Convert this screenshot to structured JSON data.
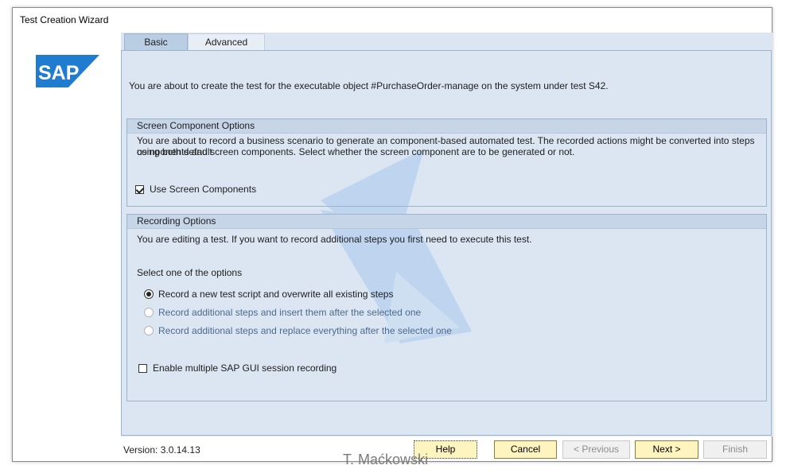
{
  "window": {
    "title": "Test Creation Wizard"
  },
  "logo": {
    "text": "SAP",
    "color": "#1f7ccf"
  },
  "tabs": [
    {
      "label": "Basic",
      "active": true
    },
    {
      "label": "Advanced",
      "active": false
    }
  ],
  "intro_text": "You are about to create the test for the executable object #PurchaseOrder-manage on the system under test S42.",
  "screen_component": {
    "header": "Screen Component Options",
    "description_line1": "You are about to record a business scenario to generate an component-based automated test. The recorded actions might be converted into steps using both default",
    "description_line2": "components and screen components. Select whether the screen component are to be generated or not.",
    "checkbox_label": "Use Screen Components",
    "checkbox_checked": true
  },
  "recording": {
    "header": "Recording Options",
    "description": "You are editing a test. If you want to record additional steps you first need to execute this test.",
    "select_label": "Select one of the options",
    "options": [
      {
        "label": "Record a new test script and overwrite all existing steps",
        "selected": true,
        "enabled": true
      },
      {
        "label": "Record additional steps and insert them after the selected one",
        "selected": false,
        "enabled": false
      },
      {
        "label": "Record additional steps and replace everything after the selected one",
        "selected": false,
        "enabled": false
      }
    ],
    "multi_session_label": "Enable multiple SAP GUI session recording",
    "multi_session_checked": false
  },
  "footer": {
    "version": "Version: 3.0.14.13",
    "help": "Help",
    "cancel": "Cancel",
    "previous": "< Previous",
    "next": "Next >",
    "finish": "Finish"
  },
  "author": "T. Maćkowski",
  "colors": {
    "panel_bg": "#dbe6f2",
    "header_bg": "#c6d6e8",
    "button_active": "#fdf4bf",
    "watermark": "#8fb5e6"
  }
}
